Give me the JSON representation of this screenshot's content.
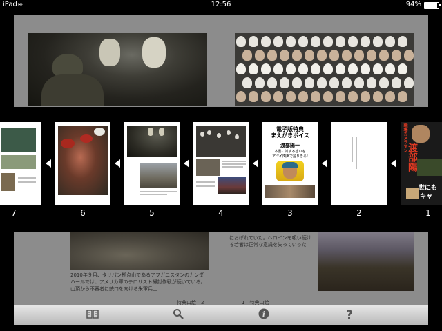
{
  "status_bar": {
    "carrier": "iPad",
    "time": "12:56",
    "battery": "94%"
  },
  "book_page": {
    "caption_right_top": "におぼれていた。ヘロインを吸い続け\nる若者は正常な意識を失っていった",
    "caption_left": "2010年９月、タリバン拠点山であるアフガニスタンのカンダ\nハールでは、アメリカ軍のテロリスト掃討作戦が続いている。\n山頂から不審者に銃口を向ける米軍兵士",
    "page_label_left": "特典口絵　2",
    "page_label_right": "1　特典口絵"
  },
  "thumbnails": [
    {
      "number": "7"
    },
    {
      "number": "6"
    },
    {
      "number": "5"
    },
    {
      "number": "4"
    },
    {
      "number": "3"
    },
    {
      "number": "2"
    },
    {
      "number": "1"
    }
  ],
  "page3_cover": {
    "line1": "電子版特典",
    "line2": "まえがきボイス",
    "author": "渡部陽一",
    "sub1": "本書に対する想いを",
    "sub2": "アツイ肉声で語りきる!"
  },
  "page1_cover": {
    "side_text": "戦場カメラマン",
    "name": "渡部陽",
    "bottom": "世にも",
    "bottom2": "キャ"
  },
  "toolbar": {
    "contents_icon": "book-icon",
    "search_icon": "search-icon",
    "info_icon": "info-icon",
    "help_icon": "help-icon"
  }
}
